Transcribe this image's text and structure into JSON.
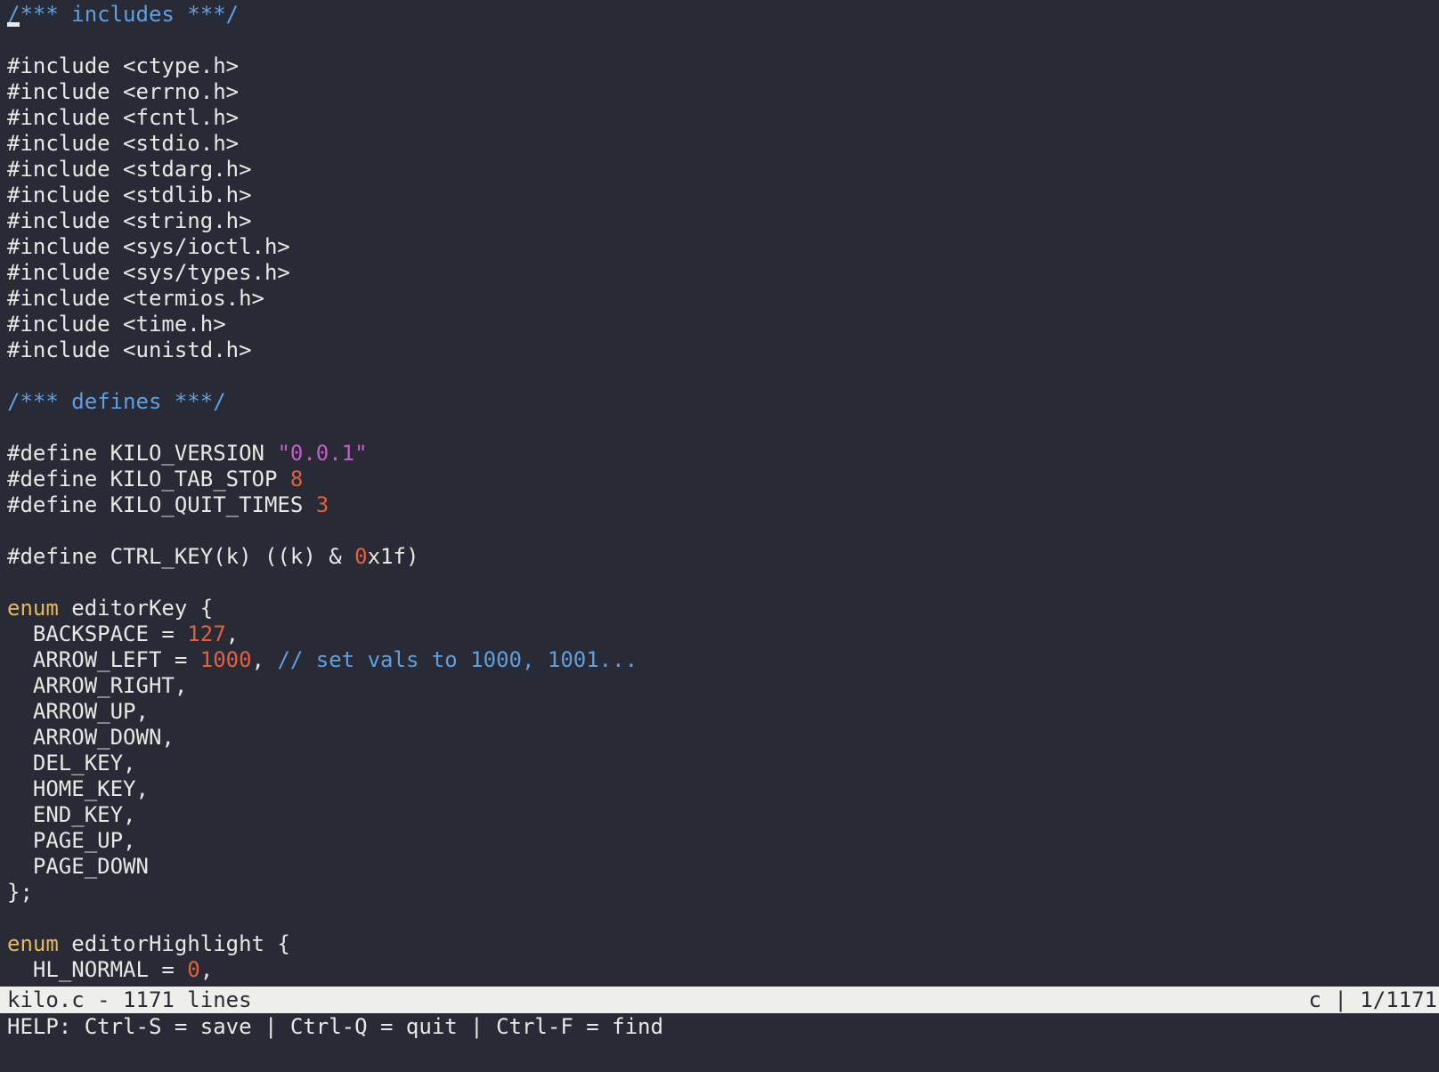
{
  "editor": {
    "name": "kilo",
    "colors": {
      "background": "#282b35",
      "foreground": "#e8e8e4",
      "comment": "#5f9fe0",
      "string": "#c25fc7",
      "number": "#e2603f",
      "keyword": "#e5b95c",
      "status_bg": "#eeefea",
      "status_fg": "#282b35"
    },
    "cursor": {
      "line": 1,
      "column": 1,
      "shape": "underline"
    },
    "lines": [
      {
        "tokens": [
          {
            "t": "comment",
            "s": "/*** includes ***/"
          }
        ]
      },
      {
        "tokens": []
      },
      {
        "tokens": [
          {
            "t": "default",
            "s": "#include <ctype.h>"
          }
        ]
      },
      {
        "tokens": [
          {
            "t": "default",
            "s": "#include <errno.h>"
          }
        ]
      },
      {
        "tokens": [
          {
            "t": "default",
            "s": "#include <fcntl.h>"
          }
        ]
      },
      {
        "tokens": [
          {
            "t": "default",
            "s": "#include <stdio.h>"
          }
        ]
      },
      {
        "tokens": [
          {
            "t": "default",
            "s": "#include <stdarg.h>"
          }
        ]
      },
      {
        "tokens": [
          {
            "t": "default",
            "s": "#include <stdlib.h>"
          }
        ]
      },
      {
        "tokens": [
          {
            "t": "default",
            "s": "#include <string.h>"
          }
        ]
      },
      {
        "tokens": [
          {
            "t": "default",
            "s": "#include <sys/ioctl.h>"
          }
        ]
      },
      {
        "tokens": [
          {
            "t": "default",
            "s": "#include <sys/types.h>"
          }
        ]
      },
      {
        "tokens": [
          {
            "t": "default",
            "s": "#include <termios.h>"
          }
        ]
      },
      {
        "tokens": [
          {
            "t": "default",
            "s": "#include <time.h>"
          }
        ]
      },
      {
        "tokens": [
          {
            "t": "default",
            "s": "#include <unistd.h>"
          }
        ]
      },
      {
        "tokens": []
      },
      {
        "tokens": [
          {
            "t": "comment",
            "s": "/*** defines ***/"
          }
        ]
      },
      {
        "tokens": []
      },
      {
        "tokens": [
          {
            "t": "default",
            "s": "#define KILO_VERSION "
          },
          {
            "t": "string",
            "s": "\"0.0.1\""
          }
        ]
      },
      {
        "tokens": [
          {
            "t": "default",
            "s": "#define KILO_TAB_STOP "
          },
          {
            "t": "number",
            "s": "8"
          }
        ]
      },
      {
        "tokens": [
          {
            "t": "default",
            "s": "#define KILO_QUIT_TIMES "
          },
          {
            "t": "number",
            "s": "3"
          }
        ]
      },
      {
        "tokens": []
      },
      {
        "tokens": [
          {
            "t": "default",
            "s": "#define CTRL_KEY(k) ((k) & "
          },
          {
            "t": "number",
            "s": "0"
          },
          {
            "t": "default",
            "s": "x1f)"
          }
        ]
      },
      {
        "tokens": []
      },
      {
        "tokens": [
          {
            "t": "keyword",
            "s": "enum"
          },
          {
            "t": "default",
            "s": " editorKey {"
          }
        ]
      },
      {
        "tokens": [
          {
            "t": "default",
            "s": "  BACKSPACE = "
          },
          {
            "t": "number",
            "s": "127"
          },
          {
            "t": "default",
            "s": ","
          }
        ]
      },
      {
        "tokens": [
          {
            "t": "default",
            "s": "  ARROW_LEFT = "
          },
          {
            "t": "number",
            "s": "1000"
          },
          {
            "t": "default",
            "s": ", "
          },
          {
            "t": "comment",
            "s": "// set vals to 1000, 1001..."
          }
        ]
      },
      {
        "tokens": [
          {
            "t": "default",
            "s": "  ARROW_RIGHT,"
          }
        ]
      },
      {
        "tokens": [
          {
            "t": "default",
            "s": "  ARROW_UP,"
          }
        ]
      },
      {
        "tokens": [
          {
            "t": "default",
            "s": "  ARROW_DOWN,"
          }
        ]
      },
      {
        "tokens": [
          {
            "t": "default",
            "s": "  DEL_KEY,"
          }
        ]
      },
      {
        "tokens": [
          {
            "t": "default",
            "s": "  HOME_KEY,"
          }
        ]
      },
      {
        "tokens": [
          {
            "t": "default",
            "s": "  END_KEY,"
          }
        ]
      },
      {
        "tokens": [
          {
            "t": "default",
            "s": "  PAGE_UP,"
          }
        ]
      },
      {
        "tokens": [
          {
            "t": "default",
            "s": "  PAGE_DOWN"
          }
        ]
      },
      {
        "tokens": [
          {
            "t": "default",
            "s": "};"
          }
        ]
      },
      {
        "tokens": []
      },
      {
        "tokens": [
          {
            "t": "keyword",
            "s": "enum"
          },
          {
            "t": "default",
            "s": " editorHighlight {"
          }
        ]
      },
      {
        "tokens": [
          {
            "t": "default",
            "s": "  HL_NORMAL = "
          },
          {
            "t": "number",
            "s": "0"
          },
          {
            "t": "default",
            "s": ","
          }
        ]
      }
    ]
  },
  "status_bar": {
    "left": "kilo.c - 1171 lines",
    "right": "c | 1/1171",
    "filename": "kilo.c",
    "line_count": "1171",
    "filetype": "c",
    "position": "1/1171"
  },
  "message_bar": {
    "text": "HELP: Ctrl-S = save | Ctrl-Q = quit | Ctrl-F = find"
  }
}
